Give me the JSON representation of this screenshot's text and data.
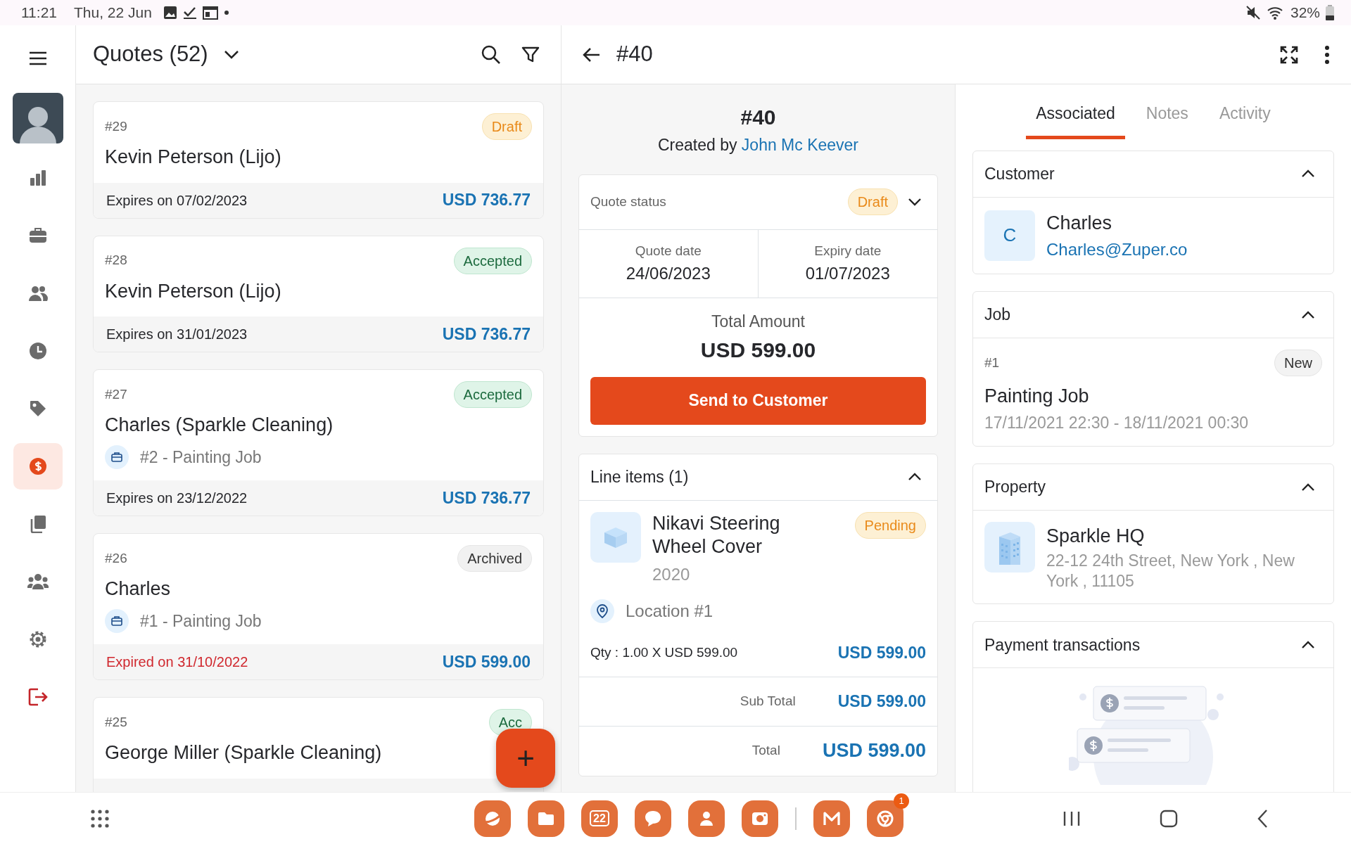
{
  "status_bar": {
    "time": "11:21",
    "date": "Thu, 22 Jun",
    "battery": "32%"
  },
  "nav_rail": [
    {
      "kind": "menu",
      "selected": false
    },
    {
      "kind": "avatar",
      "selected": false
    },
    {
      "kind": "chart",
      "selected": false
    },
    {
      "kind": "briefcase",
      "selected": false
    },
    {
      "kind": "people",
      "selected": false
    },
    {
      "kind": "clock",
      "selected": false
    },
    {
      "kind": "tag",
      "selected": false
    },
    {
      "kind": "dollar",
      "selected": true
    },
    {
      "kind": "documents",
      "selected": false
    },
    {
      "kind": "team",
      "selected": false
    },
    {
      "kind": "gear",
      "selected": false
    },
    {
      "kind": "logout",
      "selected": false
    }
  ],
  "list_header": {
    "title": "Quotes (52)"
  },
  "quotes": [
    {
      "number": "#29",
      "status": "Draft",
      "kind": "draft",
      "customer": "Kevin Peterson (Lijo)",
      "expiry": "Expires on 07/02/2023",
      "expired": false,
      "amount": "USD 736.77"
    },
    {
      "number": "#28",
      "status": "Accepted",
      "kind": "accepted",
      "customer": "Kevin Peterson (Lijo)",
      "expiry": "Expires on 31/01/2023",
      "expired": false,
      "amount": "USD 736.77"
    },
    {
      "number": "#27",
      "status": "Accepted",
      "kind": "accepted",
      "customer": "Charles (Sparkle Cleaning)",
      "job": "#2 - Painting Job",
      "expiry": "Expires on 23/12/2022",
      "expired": false,
      "amount": "USD 736.77"
    },
    {
      "number": "#26",
      "status": "Archived",
      "kind": "archived",
      "customer": "Charles",
      "job": "#1 - Painting Job",
      "expiry": "Expired on 31/10/2022",
      "expired": true,
      "amount": "USD 599.00"
    },
    {
      "number": "#25",
      "status": "Acc",
      "kind": "accepted",
      "customer": "George Miller (Sparkle Cleaning)"
    }
  ],
  "fab": {
    "label": "+"
  },
  "detail": {
    "title": "#40",
    "heading": "#40",
    "created_by_label": "Created by",
    "created_by": "John Mc Keever",
    "quote_status_label": "Quote status",
    "status": "Draft",
    "kind": "draft",
    "quote_date_label": "Quote date",
    "quote_date": "24/06/2023",
    "expiry_label": "Expiry date",
    "expiry_date": "01/07/2023",
    "total_label": "Total Amount",
    "total": "USD 599.00",
    "send_button": "Send to Customer",
    "line_items": {
      "title": "Line items (1)",
      "expanded": true,
      "items": [
        {
          "name": "Nikavi Steering Wheel Cover",
          "year": "2020",
          "status": "Pending",
          "kind": "draft",
          "location": "Location #1",
          "qty": "Qty : 1.00 X USD 599.00",
          "amount": "USD 599.00"
        }
      ]
    },
    "sub_total_label": "Sub Total",
    "sub_total": "USD 599.00",
    "grand_total_label": "Total",
    "grand_total": "USD 599.00"
  },
  "tabs": [
    {
      "label": "Associated",
      "selected": true
    },
    {
      "label": "Notes",
      "selected": false
    },
    {
      "label": "Activity",
      "selected": false
    }
  ],
  "sections": [
    {
      "kind": "customer",
      "title": "Customer",
      "expanded": true,
      "initial": "C",
      "name": "Charles",
      "email": "Charles@Zuper.co"
    },
    {
      "kind": "job",
      "title": "Job",
      "expanded": true,
      "number": "#1",
      "status": "New",
      "name": "Painting Job",
      "schedule": "17/11/2021 22:30 - 18/11/2021 00:30"
    },
    {
      "kind": "property",
      "title": "Property",
      "expanded": true,
      "name": "Sparkle HQ",
      "address": "22-12 24th Street, New York , New York , 11105"
    },
    {
      "kind": "payments",
      "title": "Payment transactions",
      "expanded": true
    }
  ],
  "dock": [
    {
      "kind": "browser"
    },
    {
      "kind": "files"
    },
    {
      "kind": "calendar",
      "label": "22"
    },
    {
      "kind": "chat"
    },
    {
      "kind": "contacts"
    },
    {
      "kind": "camera"
    },
    {
      "kind": "mail"
    },
    {
      "kind": "chrome",
      "badge": "1"
    }
  ]
}
